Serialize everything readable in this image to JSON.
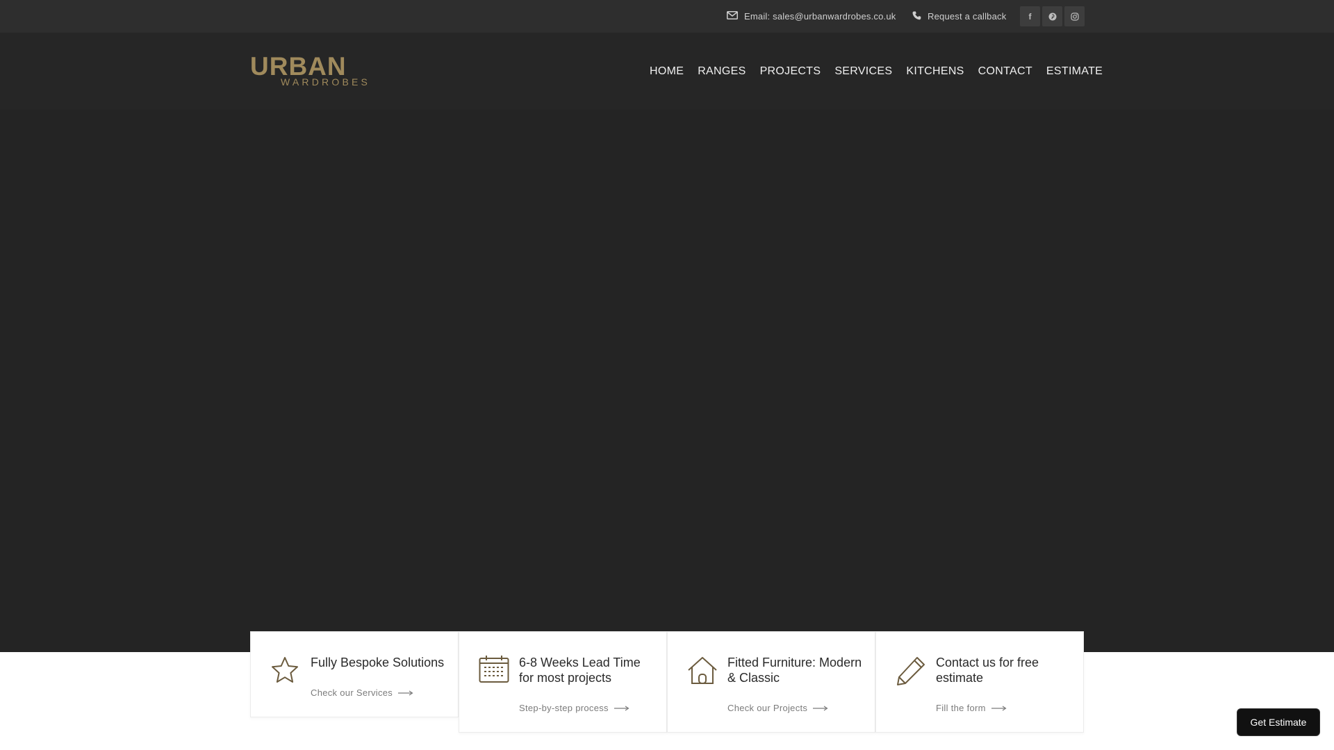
{
  "topbar": {
    "email_text": "Email: sales@urbanwardrobes.co.uk",
    "callback_text": "Request a callback",
    "email_icon": "envelope-icon",
    "callback_icon": "phone-icon",
    "socials": [
      {
        "name": "facebook-icon",
        "glyph": "f"
      },
      {
        "name": "pinterest-icon",
        "glyph": "p"
      },
      {
        "name": "instagram-icon",
        "glyph": "o"
      }
    ]
  },
  "logo": {
    "word1": "URBAN",
    "word2": "WARDROBES",
    "color": "#a08a5c"
  },
  "nav": {
    "items": [
      "HOME",
      "RANGES",
      "PROJECTS",
      "SERVICES",
      "KITCHENS",
      "CONTACT",
      "ESTIMATE"
    ]
  },
  "features": [
    {
      "title": "Fully Bespoke Solutions",
      "link": "Check our Services",
      "icon": "star-icon"
    },
    {
      "title": "6-8 Weeks Lead Time for most projects",
      "link": "Step-by-step process",
      "icon": "calendar-icon"
    },
    {
      "title": "Fitted Furniture: Modern & Classic",
      "link": "Check our Projects",
      "icon": "house-icon"
    },
    {
      "title": "Contact us for free estimate",
      "link": "Fill the form",
      "icon": "pencil-icon"
    }
  ],
  "floating": {
    "estimate_label": "Get Estimate"
  },
  "colors": {
    "accent": "#6b5b3e",
    "topbar": "#2e2e2e",
    "header": "#262626",
    "hero": "#242424"
  }
}
